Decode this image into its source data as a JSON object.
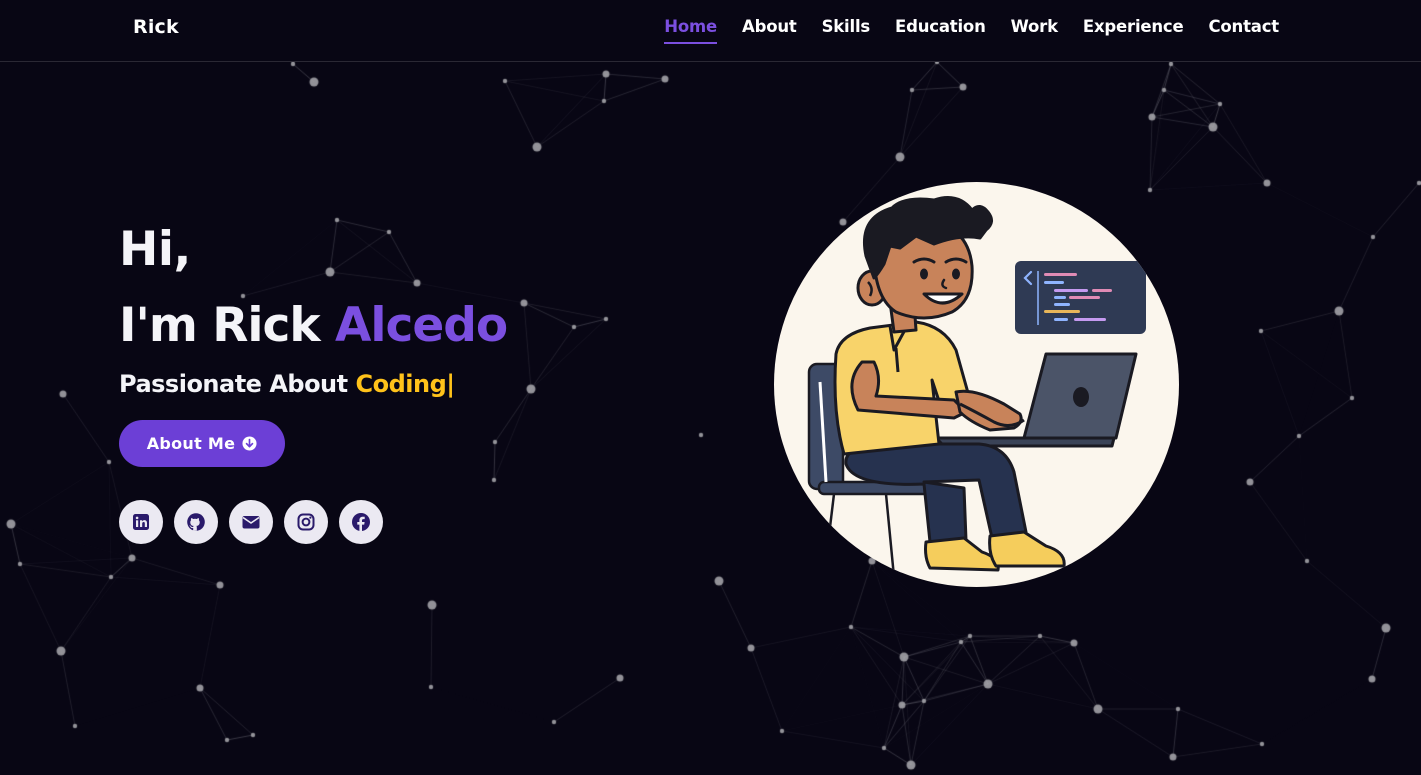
{
  "nav": {
    "brand": "Rick",
    "links": [
      {
        "label": "Home",
        "active": true
      },
      {
        "label": "About",
        "active": false
      },
      {
        "label": "Skills",
        "active": false
      },
      {
        "label": "Education",
        "active": false
      },
      {
        "label": "Work",
        "active": false
      },
      {
        "label": "Experience",
        "active": false
      },
      {
        "label": "Contact",
        "active": false
      }
    ]
  },
  "hero": {
    "greeting": "Hi,",
    "intro_prefix": "I'm Rick",
    "intro_highlight": "Alcedo",
    "tagline_prefix": "Passionate About",
    "tagline_highlight": "Coding",
    "cursor": "|",
    "button_label": "About Me",
    "button_icon": "arrow-down-circle-icon",
    "socials": [
      {
        "name": "linkedin-icon"
      },
      {
        "name": "github-icon"
      },
      {
        "name": "envelope-icon"
      },
      {
        "name": "instagram-icon"
      },
      {
        "name": "facebook-icon"
      }
    ],
    "illustration": "developer-illustration"
  },
  "colors": {
    "background": "#080614",
    "accent_purple": "#7b4fe0",
    "button_purple": "#6c3fd6",
    "accent_yellow": "#ffc21a",
    "text": "#f4f4f8",
    "social_bg": "#ebe9f2",
    "social_icon": "#2a1a6b"
  }
}
